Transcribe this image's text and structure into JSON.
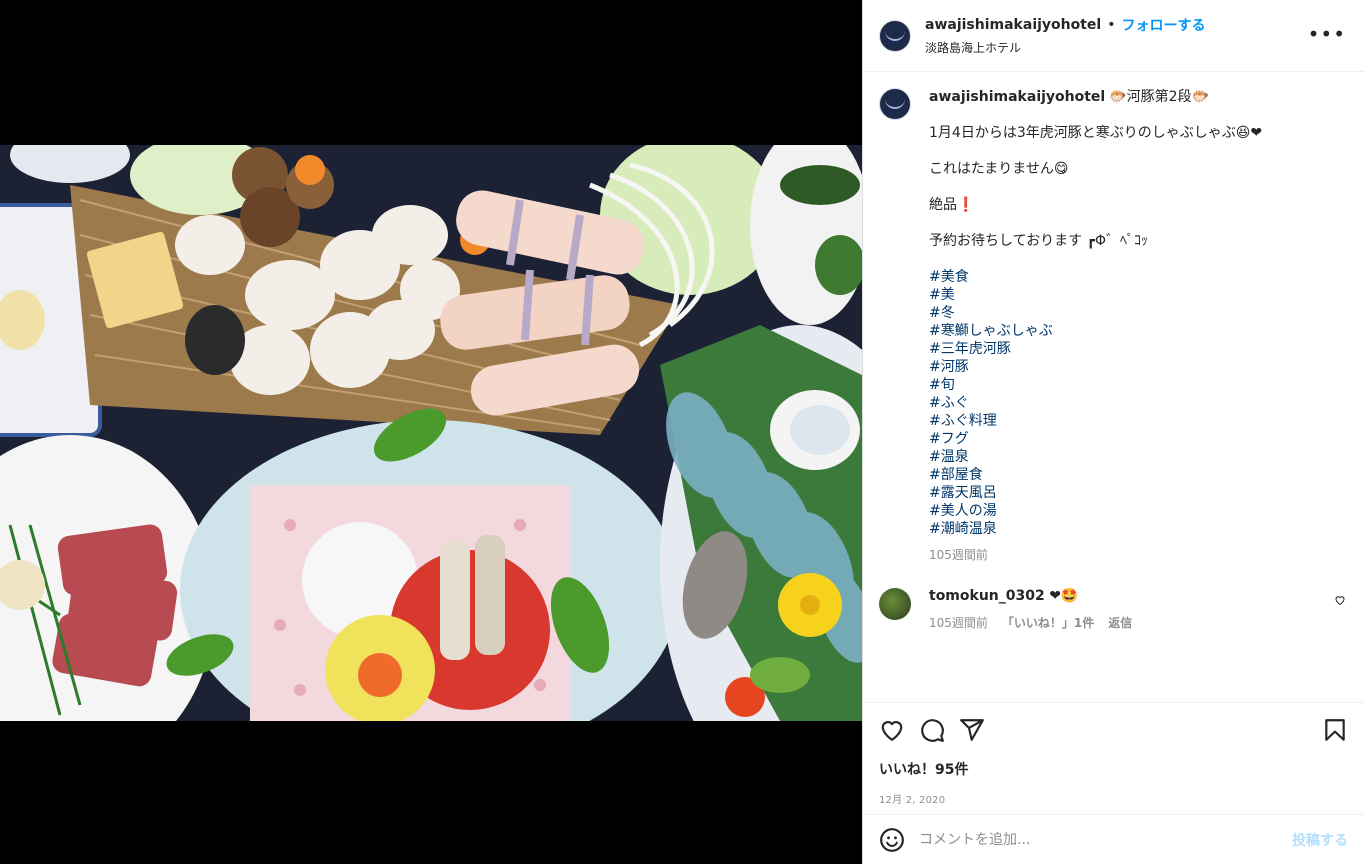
{
  "post": {
    "username": "awajishimakaijyohotel",
    "separator": "•",
    "follow_label": "フォローする",
    "location": "淡路島海上ホテル",
    "more_label": "•••"
  },
  "caption": {
    "username": "awajishimakaijyohotel",
    "title": "🐡河豚第2段🐡",
    "lines": [
      "1月4日からは3年虎河豚と寒ぶりのしゃぶしゃぶ😆❤",
      "これはたまりません😋",
      "絶品❗",
      "予約お待ちしております ┏Φ゛ﾍﾟｺｯ"
    ],
    "hashtags": [
      "#美食",
      "#美",
      "#冬",
      "#寒鰤しゃぶしゃぶ",
      "#三年虎河豚",
      "#河豚",
      "#旬",
      "#ふぐ",
      "#ふぐ料理",
      "#フグ",
      "#温泉",
      "#部屋食",
      "#露天風呂",
      "#美人の湯",
      "#潮崎温泉"
    ],
    "time": "105週間前"
  },
  "reply": {
    "username": "tomokun_0302",
    "text": "❤🤩",
    "time": "105週間前",
    "likes_label": "「いいね！」1件",
    "reply_label": "返信"
  },
  "actions": {
    "icons": [
      "heart-icon",
      "comment-icon",
      "share-icon",
      "bookmark-icon"
    ],
    "likes": "いいね！95件",
    "date": "12月 2, 2020"
  },
  "comment_box": {
    "placeholder": "コメントを追加...",
    "post_label": "投稿する"
  },
  "colors": {
    "link": "#0095f6",
    "hashtag": "#00376b",
    "muted": "#8e8e8e",
    "post_disabled": "#b2dffc"
  }
}
